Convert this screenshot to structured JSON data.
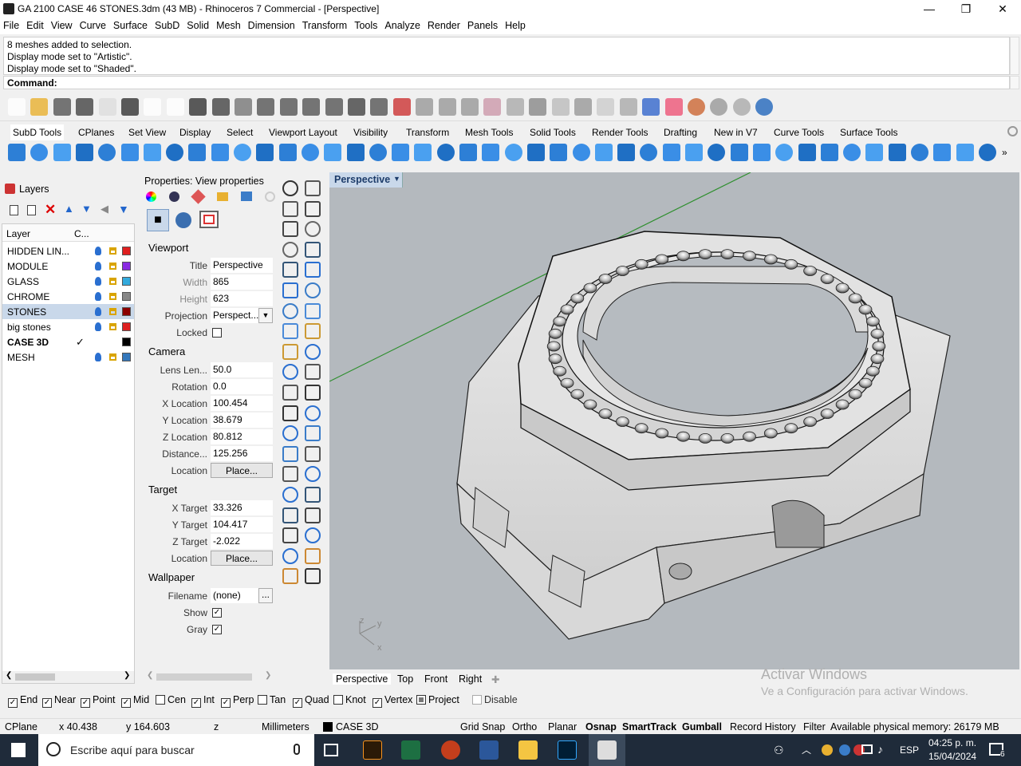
{
  "window": {
    "title": "GA 2100 CASE 46 STONES.3dm (43 MB) - Rhinoceros 7 Commercial - [Perspective]",
    "minimize": "—",
    "maximize": "❐",
    "close": "✕"
  },
  "menu": [
    "File",
    "Edit",
    "View",
    "Curve",
    "Surface",
    "SubD",
    "Solid",
    "Mesh",
    "Dimension",
    "Transform",
    "Tools",
    "Analyze",
    "Render",
    "Panels",
    "Help"
  ],
  "history": [
    "8 meshes added to selection.",
    "Display mode set to \"Artistic\".",
    "Display mode set to \"Shaded\"."
  ],
  "command": {
    "label": "Command:"
  },
  "toolbar_tabs": [
    "SubD Tools",
    "CPlanes",
    "Set View",
    "Display",
    "Select",
    "Viewport Layout",
    "Visibility",
    "Transform",
    "Mesh Tools",
    "Solid Tools",
    "Render Tools",
    "Drafting",
    "New in V7",
    "Curve Tools",
    "Surface Tools"
  ],
  "layers": {
    "title": "Layers",
    "col_layer": "Layer",
    "col_c": "C...",
    "items": [
      {
        "name": "HIDDEN LIN...",
        "color": "#e02020"
      },
      {
        "name": "MODULE",
        "color": "#8a2be2"
      },
      {
        "name": "GLASS",
        "color": "#33aadd"
      },
      {
        "name": "CHROME",
        "color": "#888888"
      },
      {
        "name": "STONES",
        "color": "#8b0000",
        "selected": true
      },
      {
        "name": "big stones",
        "color": "#dd2020"
      },
      {
        "name": "CASE 3D",
        "color": "#000000",
        "current": true,
        "check": "✓"
      },
      {
        "name": "MESH",
        "color": "#3377bb"
      }
    ]
  },
  "properties": {
    "title": "Properties: View properties",
    "viewport_header": "Viewport",
    "title_label": "Title",
    "title_value": "Perspective",
    "width_label": "Width",
    "width_value": "865",
    "height_label": "Height",
    "height_value": "623",
    "projection_label": "Projection",
    "projection_value": "Perspect...",
    "locked_label": "Locked",
    "camera_header": "Camera",
    "lens_label": "Lens Len...",
    "lens_value": "50.0",
    "rotation_label": "Rotation",
    "rotation_value": "0.0",
    "xloc_label": "X Location",
    "xloc_value": "100.454",
    "yloc_label": "Y Location",
    "yloc_value": "38.679",
    "zloc_label": "Z Location",
    "zloc_value": "80.812",
    "dist_label": "Distance...",
    "dist_value": "125.256",
    "loc_label": "Location",
    "place_btn": "Place...",
    "target_header": "Target",
    "xt_label": "X Target",
    "xt_value": "33.326",
    "yt_label": "Y Target",
    "yt_value": "104.417",
    "zt_label": "Z Target",
    "zt_value": "-2.022",
    "wallpaper_header": "Wallpaper",
    "filename_label": "Filename",
    "filename_value": "(none)",
    "browse": "...",
    "show_label": "Show",
    "gray_label": "Gray",
    "check": "✓"
  },
  "viewport": {
    "label": "Perspective",
    "watermark1": "Activar Windows",
    "watermark2": "Ve a Configuración para activar Windows.",
    "axis_z": "z",
    "axis_y": "y",
    "axis_x": "x"
  },
  "viewport_tabs": [
    "Perspective",
    "Top",
    "Front",
    "Right"
  ],
  "osnap": [
    {
      "label": "End",
      "checked": true
    },
    {
      "label": "Near",
      "checked": true
    },
    {
      "label": "Point",
      "checked": true
    },
    {
      "label": "Mid",
      "checked": true
    },
    {
      "label": "Cen",
      "checked": false
    },
    {
      "label": "Int",
      "checked": true
    },
    {
      "label": "Perp",
      "checked": true
    },
    {
      "label": "Tan",
      "checked": false
    },
    {
      "label": "Quad",
      "checked": true
    },
    {
      "label": "Knot",
      "checked": false
    },
    {
      "label": "Vertex",
      "checked": true
    },
    {
      "label": "Project",
      "checked": false
    },
    {
      "label": "Disable",
      "checked": false
    }
  ],
  "status": {
    "cplane": "CPlane",
    "x": "x 40.438",
    "y": "y 164.603",
    "z": "z",
    "units": "Millimeters",
    "layer": "CASE 3D",
    "grid_snap": "Grid Snap",
    "ortho": "Ortho",
    "planar": "Planar",
    "osnap": "Osnap",
    "smarttrack": "SmartTrack",
    "gumball": "Gumball",
    "record_history": "Record History",
    "filter": "Filter",
    "memory": "Available physical memory: 26179 MB"
  },
  "taskbar": {
    "search": "Escribe aquí para buscar",
    "lang": "ESP",
    "time": "04:25 p. m.",
    "date": "15/04/2024",
    "notif": "6"
  }
}
